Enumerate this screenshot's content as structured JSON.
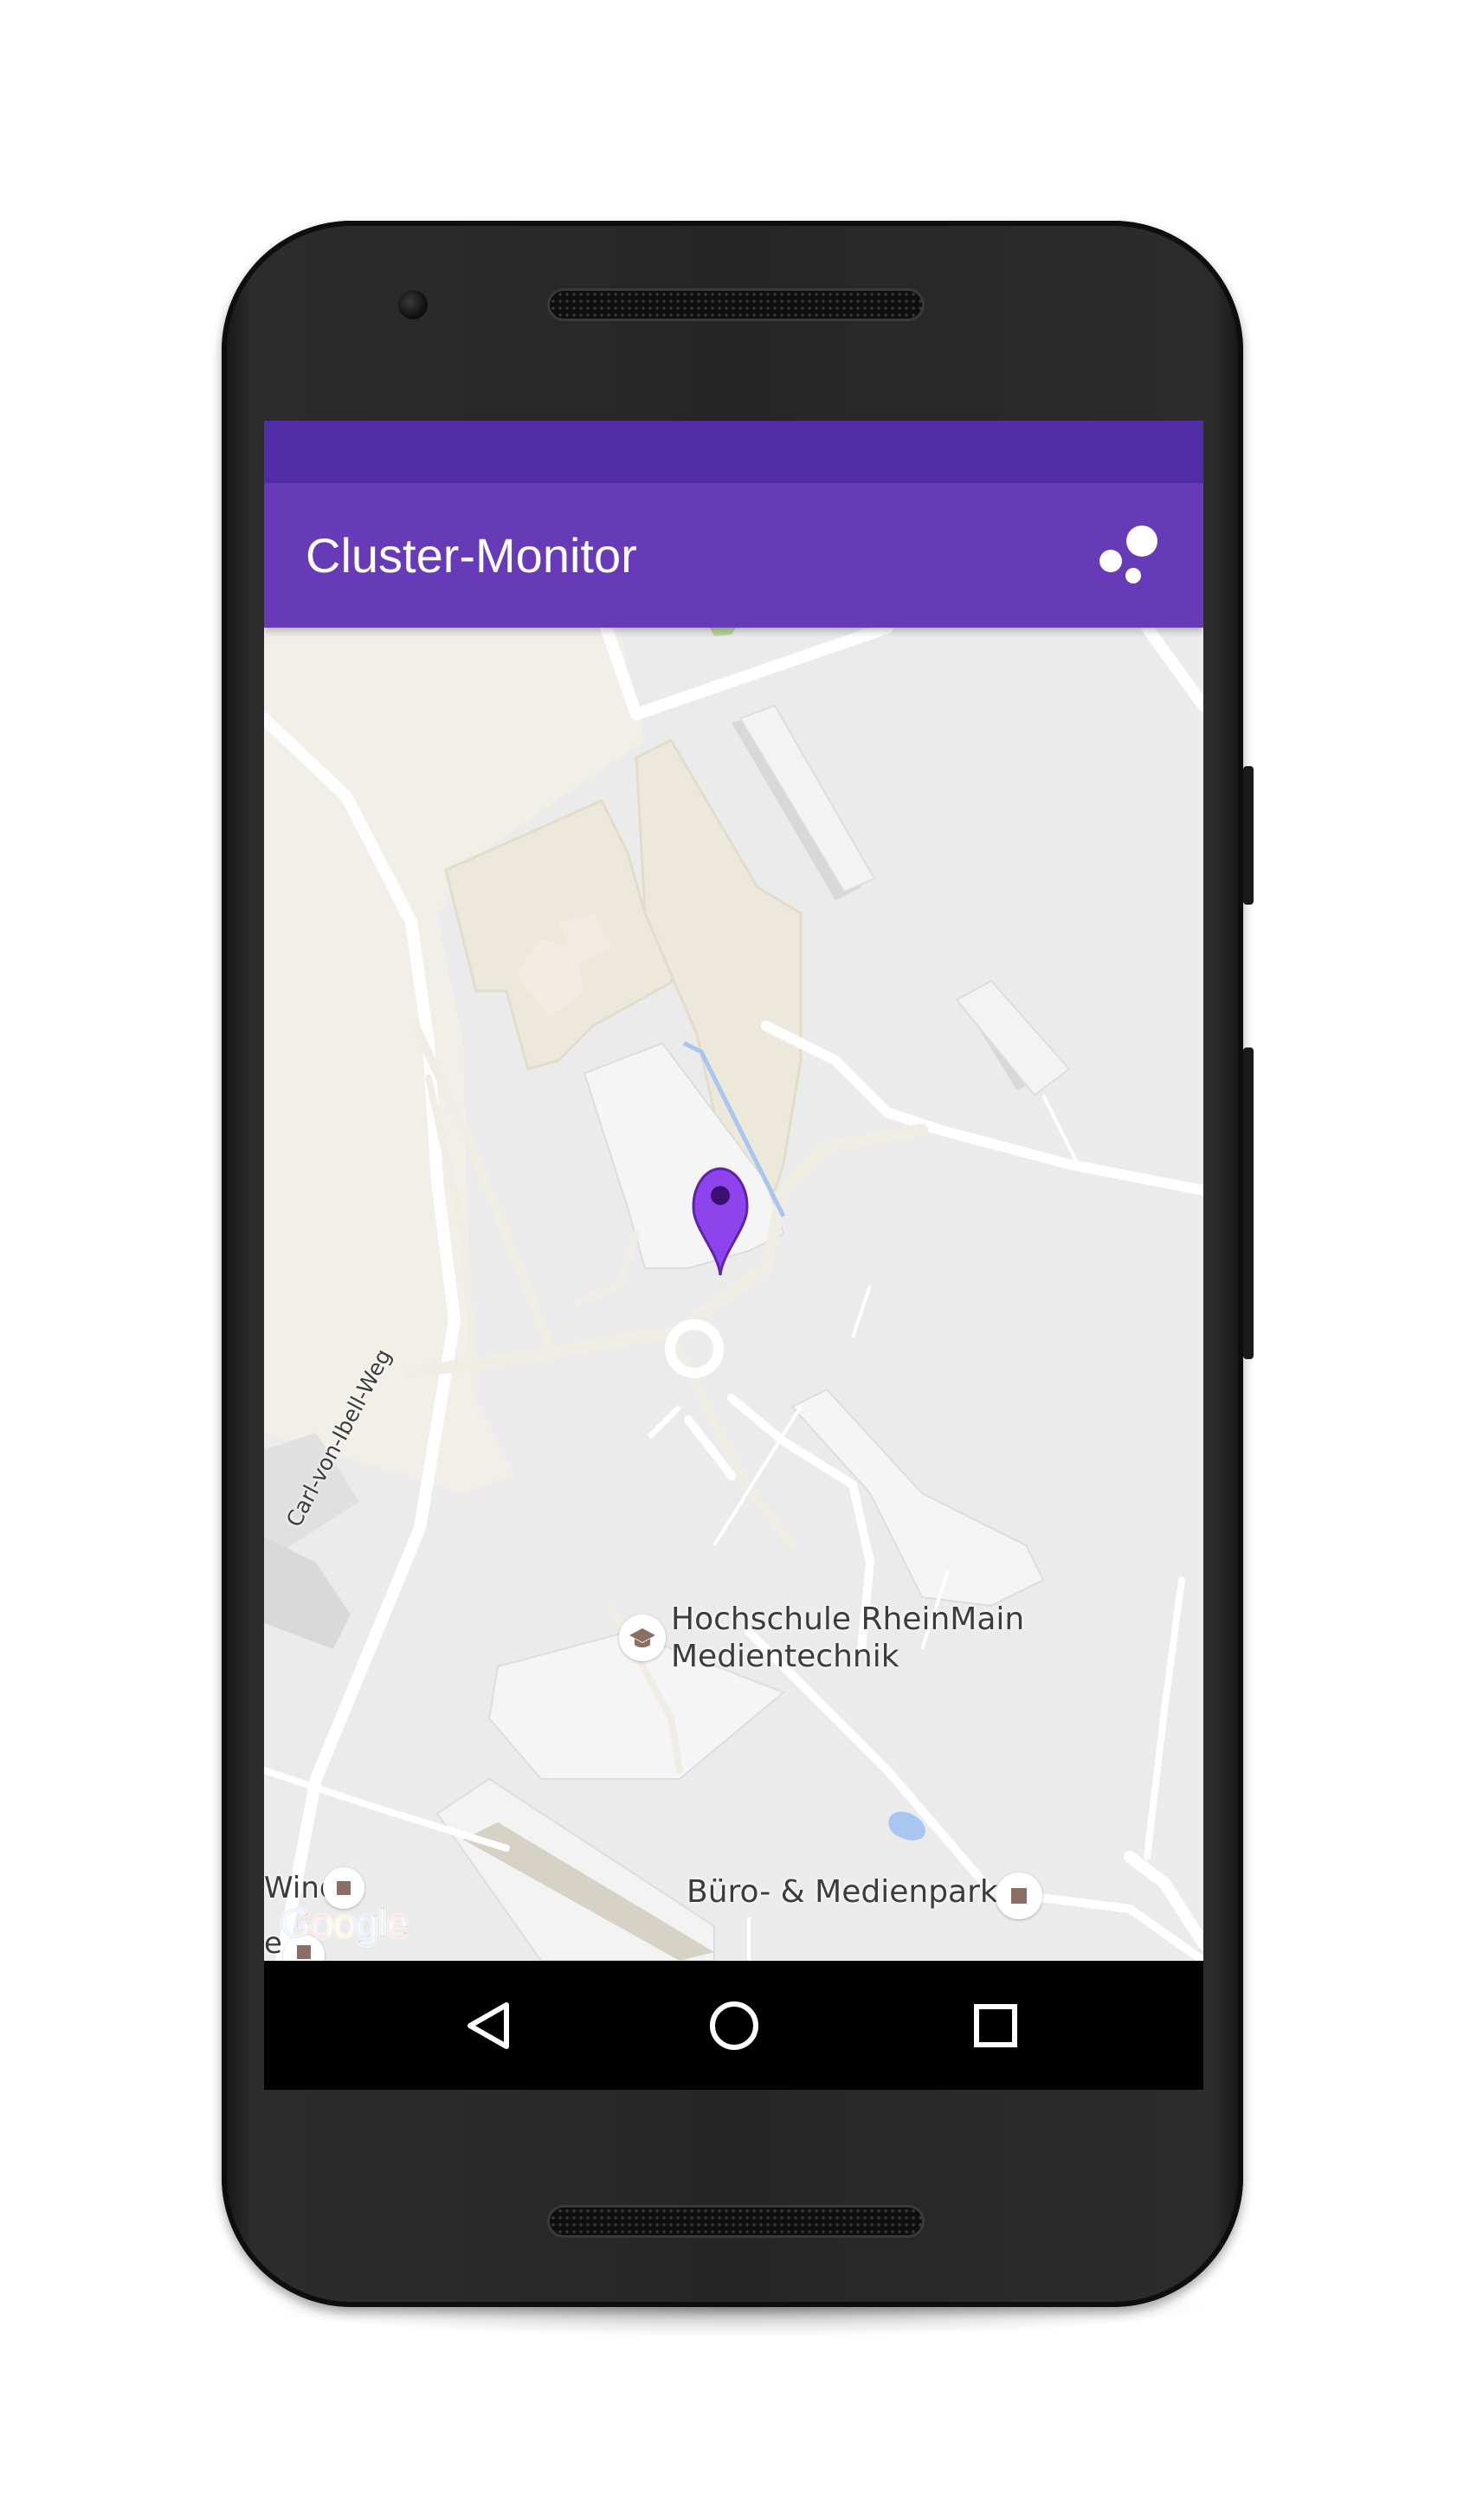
{
  "app_bar": {
    "title": "Cluster-Monitor",
    "action_icon": "cluster-dots-icon"
  },
  "map": {
    "labels": {
      "hochschule_line1": "Hochschule RheinMain",
      "hochschule_line2": "Medientechnik",
      "buero": "Büro- & Medienpark",
      "street": "Carl-von-Ibell-Weg",
      "wind": "Wind",
      "fragment": "e"
    },
    "attribution": "Google",
    "marker_icon": "location-pin-icon"
  },
  "nav_bar": {
    "back_icon": "back-triangle-icon",
    "home_icon": "home-circle-icon",
    "recents_icon": "recents-square-icon"
  },
  "colors": {
    "status_bar": "#512da8",
    "app_bar": "#673ab7",
    "marker": "#8e44ec",
    "map_background": "#ebebeb"
  }
}
